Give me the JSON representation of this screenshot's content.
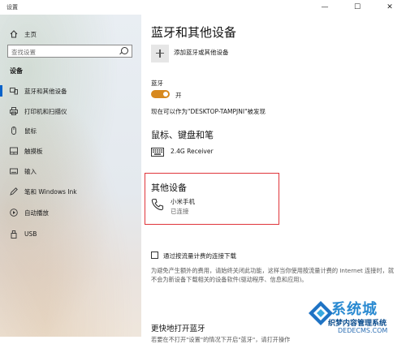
{
  "window": {
    "title": "设置",
    "controls": [
      "—",
      "☐",
      "✕"
    ]
  },
  "sidebar": {
    "home": "主页",
    "search_placeholder": "查找设置",
    "section": "设备",
    "items": [
      {
        "label": "蓝牙和其他设备",
        "icon": "bluetooth-devices-icon",
        "active": true
      },
      {
        "label": "打印机和扫描仪",
        "icon": "printer-icon"
      },
      {
        "label": "鼠标",
        "icon": "mouse-icon"
      },
      {
        "label": "触摸板",
        "icon": "touchpad-icon"
      },
      {
        "label": "输入",
        "icon": "keyboard-icon"
      },
      {
        "label": "笔和 Windows Ink",
        "icon": "pen-icon"
      },
      {
        "label": "自动播放",
        "icon": "autoplay-icon"
      },
      {
        "label": "USB",
        "icon": "usb-icon"
      }
    ]
  },
  "main": {
    "title": "蓝牙和其他设备",
    "add_label": "添加蓝牙或其他设备",
    "bluetooth_label": "蓝牙",
    "bluetooth_state": "开",
    "discoverable": "现在可以作为\"DESKTOP-TAMPJNI\"被发现",
    "mkp_heading": "鼠标、键盘和笔",
    "mkp_device": "2.4G Receiver",
    "other_heading": "其他设备",
    "other_device_name": "小米手机",
    "other_device_status": "已连接",
    "metered_label": "通过按流量计费的连接下载",
    "metered_desc": "为避免产生额外的费用，请始终关闭此功能，这样当你使用按流量计费的 Internet 连接时，就不会为新设备下载相关的设备软件(驱动程序、信息和应用)。",
    "quick_heading": "更快地打开蓝牙",
    "quick_desc": "若要在不打开\"设置\"的情况下开启\"蓝牙\"，请打开操作"
  },
  "watermark": {
    "brand": "系统城",
    "line1": "织梦内容管理系统",
    "line2": "DEDECMS.COM"
  },
  "colors": {
    "accent": "#0a62c9",
    "toggle_on": "#d7891f",
    "highlight": "#e0343a"
  }
}
